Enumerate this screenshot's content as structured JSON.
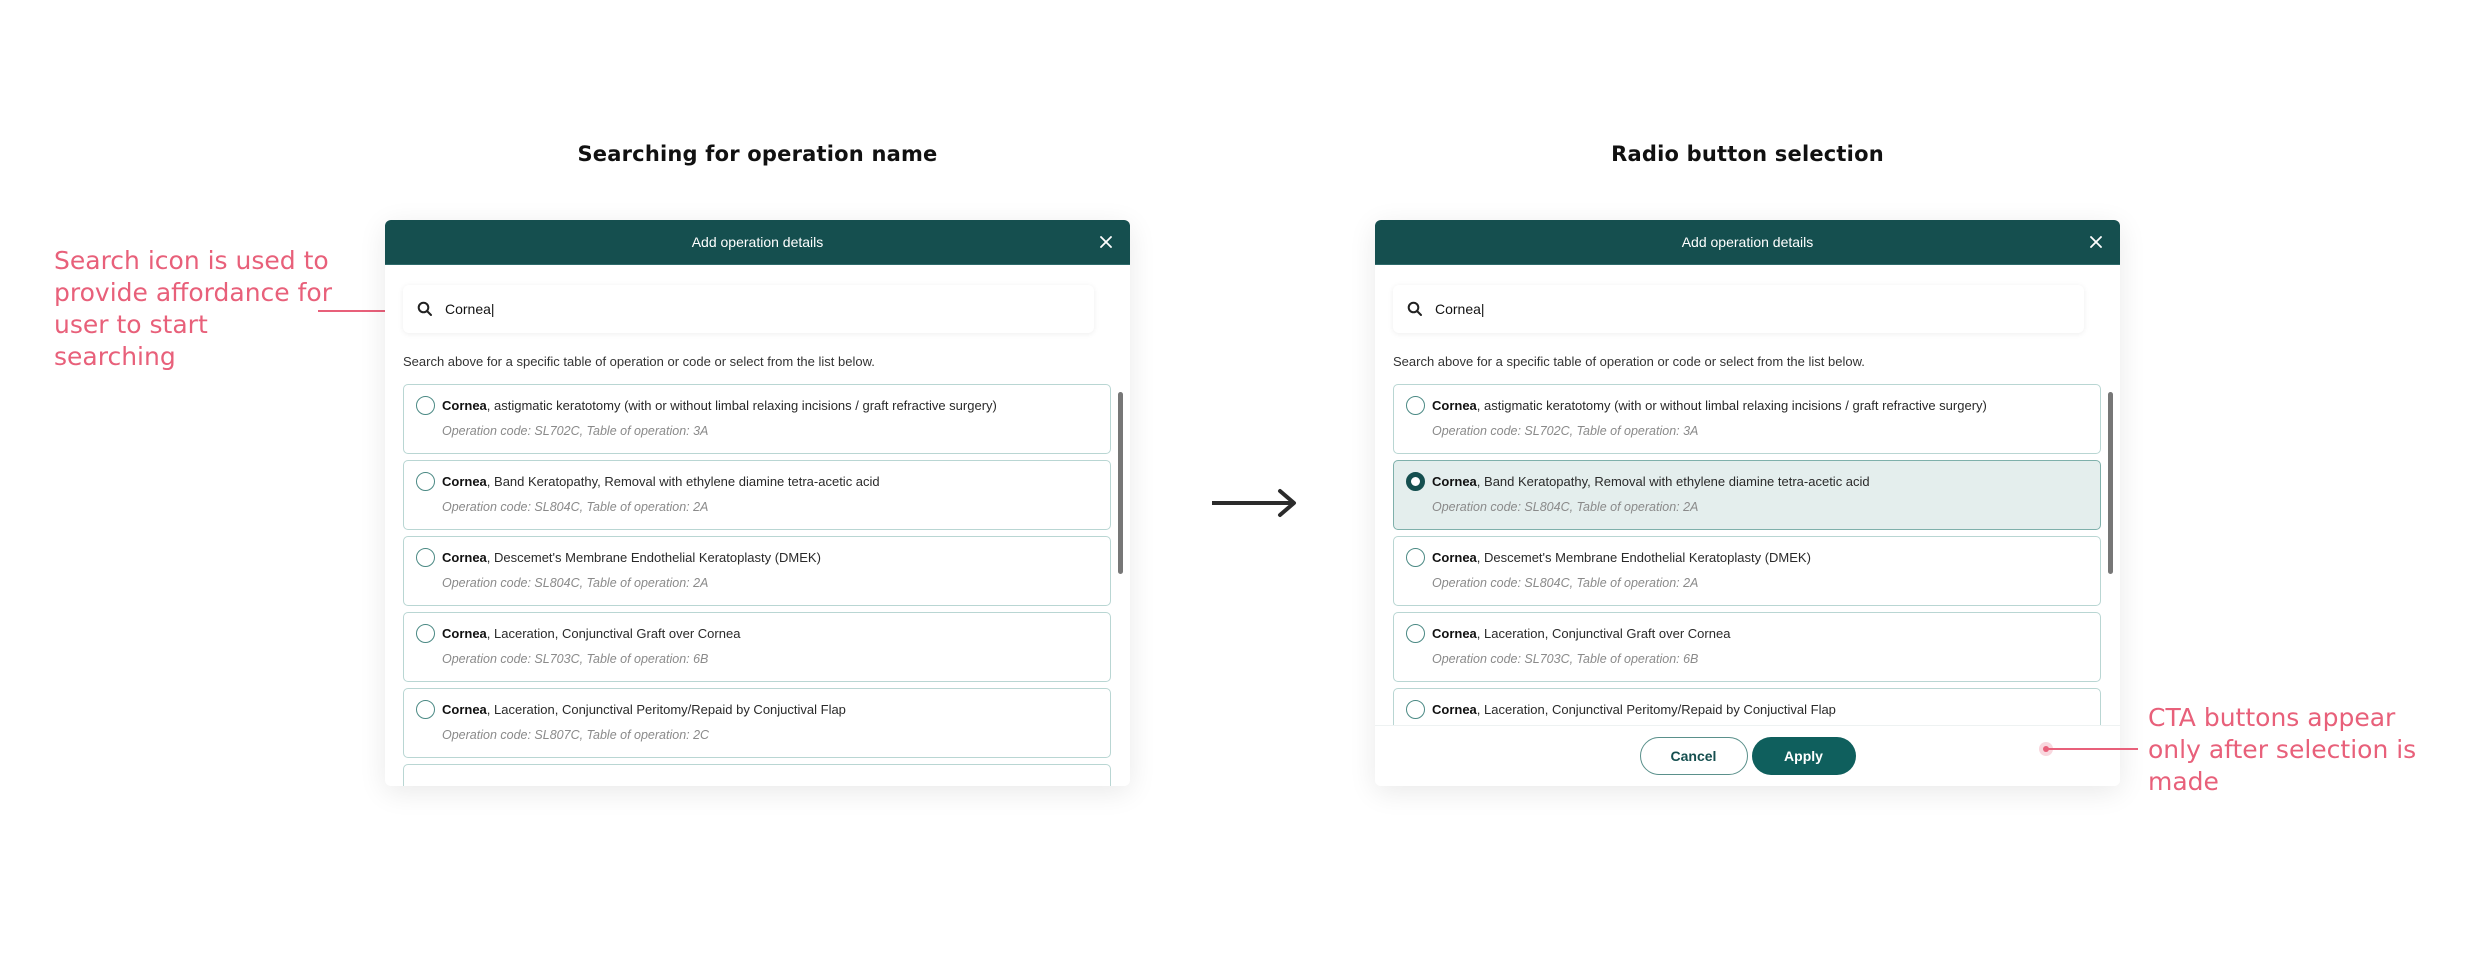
{
  "sections": {
    "left_title": "Searching for operation name",
    "right_title": "Radio button selection"
  },
  "annotations": {
    "search_icon_note": "Search icon is used to provide affordance for user to start searching",
    "cta_note": "CTA buttons appear only after selection is made"
  },
  "modal": {
    "title": "Add operation details",
    "close_icon": "close-icon",
    "search_icon": "search-icon",
    "search_value": "Cornea|",
    "helper_text": "Search above for a specific table of operation or code or select from the list below.",
    "items": [
      {
        "keyword": "Cornea",
        "title_rest": ", astigmatic keratotomy (with or without limbal relaxing incisions / graft refractive surgery)",
        "sub": "Operation code: SL702C, Table of operation: 3A"
      },
      {
        "keyword": "Cornea",
        "title_rest": ", Band Keratopathy, Removal with ethylene diamine tetra-acetic acid",
        "sub": "Operation code: SL804C, Table of operation: 2A"
      },
      {
        "keyword": "Cornea",
        "title_rest": ", Descemet's Membrane Endothelial Keratoplasty (DMEK)",
        "sub": "Operation code: SL804C, Table of operation: 2A"
      },
      {
        "keyword": "Cornea",
        "title_rest": ", Laceration, Conjunctival Graft over Cornea",
        "sub": "Operation code: SL703C, Table of operation: 6B"
      },
      {
        "keyword": "Cornea",
        "title_rest": ", Laceration, Conjunctival Peritomy/Repaid by Conjuctival Flap",
        "sub": "Operation code: SL807C, Table of operation: 2C"
      }
    ],
    "selected_index_right": 1,
    "cancel_label": "Cancel",
    "apply_label": "Apply"
  },
  "colors": {
    "header": "#154f4f",
    "accent": "#0f5f5d",
    "annotation": "#e8607a",
    "selected_bg": "#e4eeed"
  }
}
